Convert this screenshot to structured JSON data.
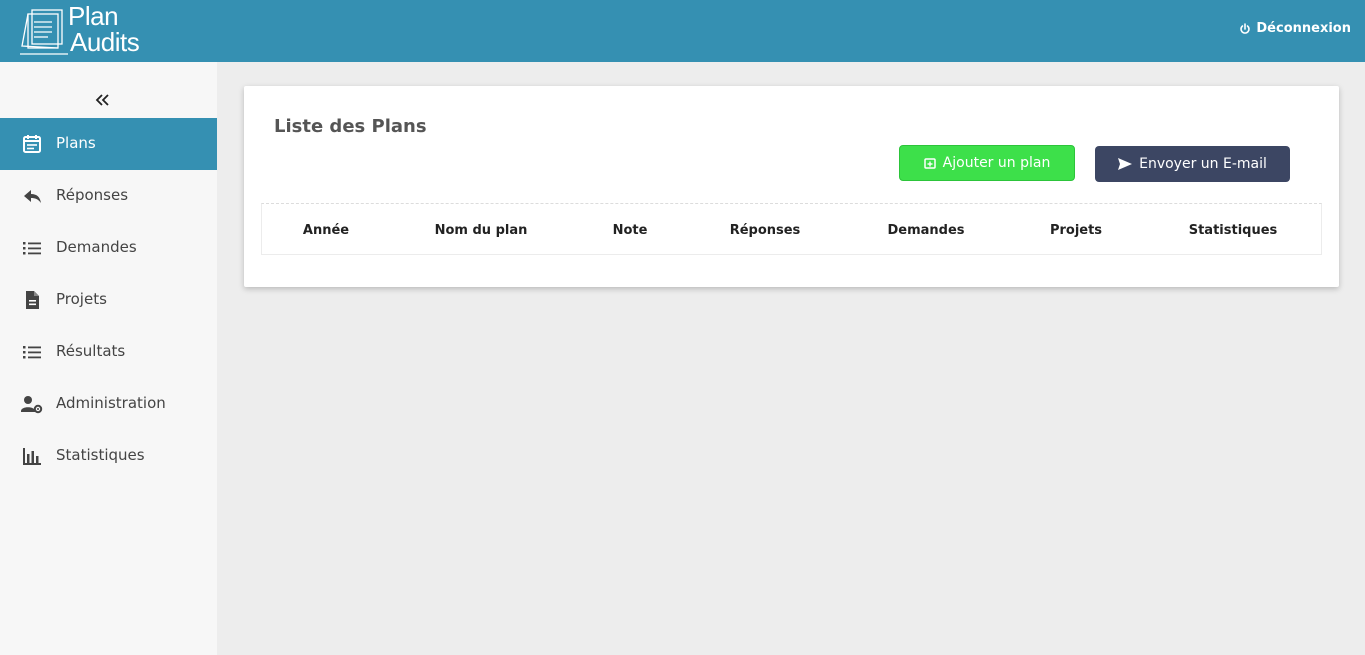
{
  "header": {
    "logo_line1": "Plan",
    "logo_line2": "Audits",
    "logout_label": "Déconnexion",
    "logout_icon": "power-icon",
    "color": "#3590b2"
  },
  "sidebar": {
    "collapse_icon": "double-chevron-left-icon",
    "items": [
      {
        "label": "Plans",
        "icon": "calendar-icon",
        "active": true
      },
      {
        "label": "Réponses",
        "icon": "reply-icon",
        "active": false
      },
      {
        "label": "Demandes",
        "icon": "list-icon",
        "active": false
      },
      {
        "label": "Projets",
        "icon": "document-icon",
        "active": false
      },
      {
        "label": "Résultats",
        "icon": "list-icon",
        "active": false
      },
      {
        "label": "Administration",
        "icon": "user-settings-icon",
        "active": false
      },
      {
        "label": "Statistiques",
        "icon": "bar-chart-icon",
        "active": false
      }
    ]
  },
  "main": {
    "title": "Liste des Plans",
    "add_button": "Ajouter un plan",
    "email_button": "Envoyer un E-mail",
    "add_color": "#3de04a",
    "email_color": "#3c4663",
    "columns": [
      "Année",
      "Nom du plan",
      "Note",
      "Réponses",
      "Demandes",
      "Projets",
      "Statistiques"
    ]
  }
}
